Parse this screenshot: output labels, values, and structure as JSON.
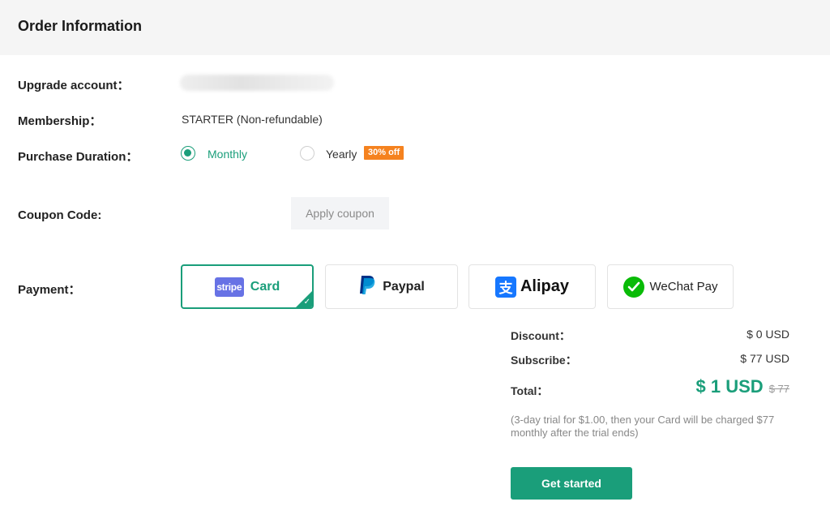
{
  "header": {
    "title": "Order Information"
  },
  "account": {
    "label": "Upgrade account："
  },
  "membership": {
    "label": "Membership：",
    "value": "STARTER (Non-refundable)"
  },
  "duration": {
    "label": "Purchase Duration：",
    "options": [
      {
        "label": "Monthly",
        "selected": true
      },
      {
        "label": "Yearly",
        "selected": false,
        "badge": "30% off"
      }
    ]
  },
  "coupon": {
    "label": "Coupon Code:",
    "placeholder": "",
    "button": "Apply coupon"
  },
  "payment": {
    "label": "Payment：",
    "methods": [
      {
        "logo_text": "stripe",
        "name": "Card",
        "selected": true,
        "icon": "stripe-icon"
      },
      {
        "name": "Paypal",
        "selected": false,
        "icon": "paypal-icon"
      },
      {
        "name": "Alipay",
        "selected": false,
        "icon": "alipay-icon"
      },
      {
        "name": "WeChat Pay",
        "selected": false,
        "icon": "wechat-icon"
      }
    ]
  },
  "summary": {
    "discount_label": "Discount：",
    "discount_value": "$ 0 USD",
    "subscribe_label": "Subscribe：",
    "subscribe_value": "$ 77 USD",
    "total_label": "Total：",
    "total_value": "$ 1 USD",
    "total_original": "$ 77",
    "note": "(3-day trial for $1.00, then your Card will be charged $77 monthly after the trial ends)"
  },
  "cta": {
    "label": "Get started"
  },
  "colors": {
    "accent": "#1a9e7a",
    "badge": "#f5821f",
    "stripe": "#6772e5",
    "paypal_dark": "#003087",
    "paypal_light": "#009cde",
    "alipay": "#1677ff",
    "wechat": "#09bb07"
  }
}
